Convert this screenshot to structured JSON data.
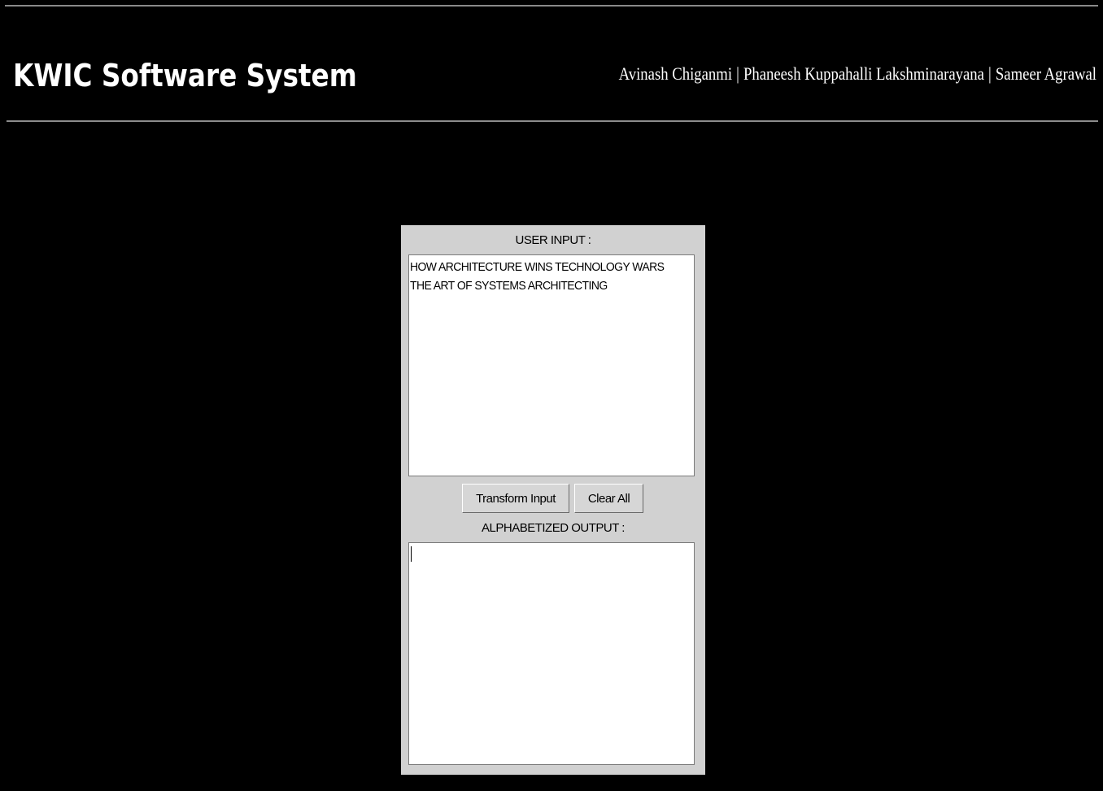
{
  "header": {
    "title": "KWIC Software System",
    "authors": [
      "Avinash Chiganmi",
      "Phaneesh Kuppahalli Lakshminarayana",
      "Sameer Agrawal"
    ],
    "separator": "|"
  },
  "panel": {
    "input_label": "USER INPUT :",
    "input_lines": [
      "HOW ARCHITECTURE WINS TECHNOLOGY WARS",
      "THE ART OF SYSTEMS ARCHITECTING"
    ],
    "transform_button_label": "Transform Input",
    "clear_button_label": "Clear All",
    "output_label": "ALPHABETIZED OUTPUT :",
    "output_value": ""
  },
  "colors": {
    "background": "#000000",
    "panel": "#d1d1d1",
    "text_area": "#ffffff",
    "header_text": "#ffffff"
  }
}
